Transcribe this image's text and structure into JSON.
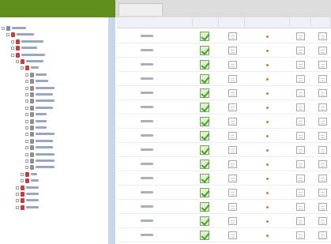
{
  "colors": {
    "brand": "#5f8f1a",
    "sidebar_scroll": "#c9d5ec",
    "folder_icon": "#c63d3d",
    "check_green": "#3fa32b",
    "status_dot": "#e2733a"
  },
  "tab": {
    "label": ""
  },
  "grid": {
    "headers": [
      "",
      "",
      "",
      "",
      "",
      ""
    ],
    "rows": [
      {
        "code": "",
        "checked": true
      },
      {
        "code": "",
        "checked": true
      },
      {
        "code": "",
        "checked": true
      },
      {
        "code": "",
        "checked": true
      },
      {
        "code": "",
        "checked": true
      },
      {
        "code": "",
        "checked": true
      },
      {
        "code": "",
        "checked": true
      },
      {
        "code": "",
        "checked": true
      },
      {
        "code": "",
        "checked": true
      },
      {
        "code": "",
        "checked": true
      },
      {
        "code": "",
        "checked": true
      },
      {
        "code": "",
        "checked": true
      },
      {
        "code": "",
        "checked": true
      },
      {
        "code": "",
        "checked": true
      },
      {
        "code": "",
        "checked": true
      }
    ]
  },
  "tree": [
    {
      "label": "",
      "icon": "root-icon",
      "kind": "root"
    },
    {
      "label": "",
      "icon": "folder-icon",
      "kind": "folder"
    },
    {
      "label": "",
      "icon": "folder-icon",
      "kind": "folder"
    },
    {
      "label": "",
      "icon": "folder-icon",
      "kind": "folder"
    },
    {
      "label": "",
      "icon": "folder-icon",
      "kind": "folder"
    },
    {
      "label": "",
      "icon": "folder-icon",
      "kind": "folder"
    },
    {
      "label": "",
      "icon": "folder-icon",
      "kind": "folder"
    },
    {
      "label": "",
      "icon": "object-icon",
      "kind": "obj"
    },
    {
      "label": "",
      "icon": "object-icon",
      "kind": "obj"
    },
    {
      "label": "",
      "icon": "object-icon",
      "kind": "obj"
    },
    {
      "label": "",
      "icon": "object-icon",
      "kind": "obj"
    },
    {
      "label": "",
      "icon": "object-icon",
      "kind": "obj"
    },
    {
      "label": "",
      "icon": "object-icon",
      "kind": "obj"
    },
    {
      "label": "",
      "icon": "object-icon",
      "kind": "obj"
    },
    {
      "label": "",
      "icon": "object-icon",
      "kind": "obj"
    },
    {
      "label": "",
      "icon": "object-icon",
      "kind": "obj"
    },
    {
      "label": "",
      "icon": "object-icon",
      "kind": "obj"
    },
    {
      "label": "",
      "icon": "object-icon",
      "kind": "obj"
    },
    {
      "label": "",
      "icon": "object-icon",
      "kind": "obj"
    },
    {
      "label": "",
      "icon": "object-icon",
      "kind": "obj"
    },
    {
      "label": "",
      "icon": "object-icon",
      "kind": "obj"
    },
    {
      "label": "",
      "icon": "object-icon",
      "kind": "obj"
    },
    {
      "label": "",
      "icon": "folder-icon",
      "kind": "folder"
    },
    {
      "label": "",
      "icon": "folder-icon",
      "kind": "folder"
    },
    {
      "label": "",
      "icon": "folder-icon",
      "kind": "folder"
    },
    {
      "label": "",
      "icon": "folder-icon",
      "kind": "folder"
    },
    {
      "label": "",
      "icon": "folder-icon",
      "kind": "folder"
    },
    {
      "label": "",
      "icon": "folder-icon",
      "kind": "folder"
    }
  ]
}
